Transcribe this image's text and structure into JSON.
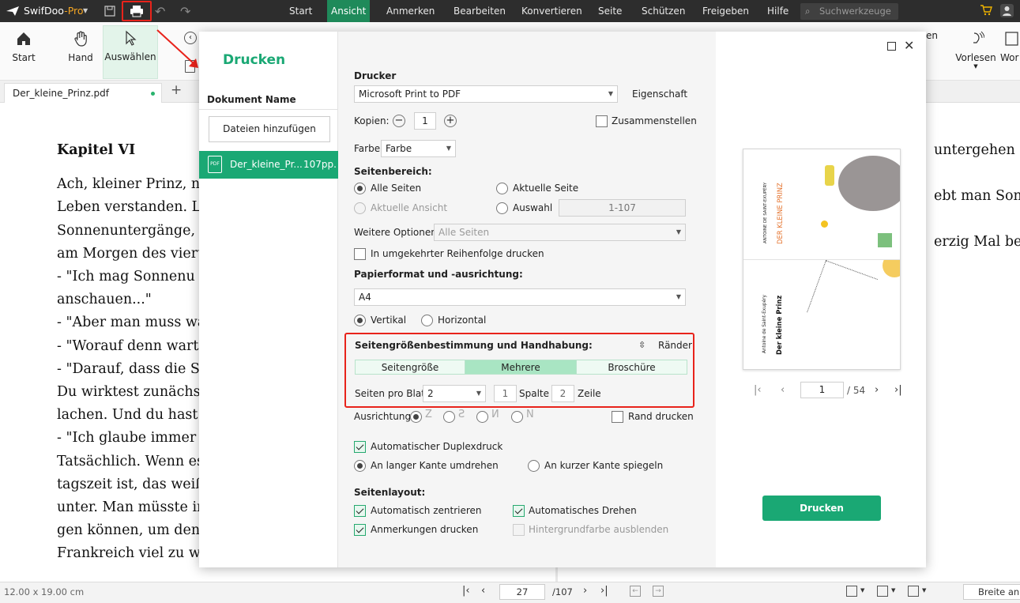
{
  "app": {
    "name": "SwifDoo",
    "suffix": "-Pro"
  },
  "menu": {
    "items": [
      "Start",
      "Ansicht",
      "Anmerken",
      "Bearbeiten",
      "Konvertieren",
      "Seite",
      "Schützen",
      "Freigeben",
      "Hilfe"
    ],
    "active": "Ansicht",
    "search_placeholder": "Suchwerkzeuge"
  },
  "toolbar": {
    "start": "Start",
    "hand": "Hand",
    "select": "Auswählen",
    "read_aloud": "Vorlesen",
    "wor": "Wor",
    "en": "en"
  },
  "tab": {
    "name": "Der_kleine_Prinz.pdf"
  },
  "document": {
    "left_lines": [
      "Kapitel VI",
      "Ach, kleiner Prinz, na",
      "Leben verstanden. La",
      "Sonnenuntergänge, un",
      "am Morgen des vierte",
      "- \"Ich mag Sonnenu",
      "anschauen...\"",
      "- \"Aber man muss wa",
      "- \"Worauf denn warten",
      "- \"Darauf, dass die So",
      "Du wirktest zunächst",
      "lachen. Und du hast zu",
      "- \"Ich glaube immer n",
      "Tatsächlich. Wenn es",
      "tagszeit ist, das weiß",
      "unter. Man müsste in",
      "gen können, um den",
      "Frankreich viel zu we"
    ],
    "right_lines": [
      "untergehen sel",
      "ebt man Sonne",
      "erzig Mal besor"
    ]
  },
  "status": {
    "page_size": "12.00 x 19.00 cm",
    "current_page": "27",
    "total_pages": "/107",
    "zoom": "Breite anp"
  },
  "dialog": {
    "title": "Drucken",
    "doc_header": "Dokument Name",
    "add_files": "Dateien hinzufügen",
    "file_name": "Der_kleine_Pr...",
    "file_pages": "107pp.",
    "printer_label": "Drucker",
    "printer_value": "Microsoft Print to PDF",
    "properties": "Eigenschaft",
    "copies_label": "Kopien:",
    "copies_value": "1",
    "collate": "Zusammenstellen",
    "color_label": "Farbe",
    "color_value": "Farbe",
    "range_label": "Seitenbereich:",
    "all_pages": "Alle Seiten",
    "current_page": "Aktuelle Seite",
    "current_view": "Aktuelle Ansicht",
    "selection": "Auswahl",
    "selection_value": "1-107",
    "more_options": "Weitere Optionen:",
    "more_options_value": "Alle Seiten",
    "reverse": "In umgekehrter Reihenfolge drucken",
    "paper_label": "Papierformat und -ausrichtung:",
    "paper_value": "A4",
    "portrait": "Vertikal",
    "landscape": "Horizontal",
    "sizing_label": "Seitengrößenbestimmung und Handhabung:",
    "margins": "Ränder",
    "seg_page_size": "Seitengröße",
    "seg_multiple": "Mehrere",
    "seg_booklet": "Broschüre",
    "pages_per_sheet_label": "Seiten pro Blatt:",
    "pages_per_sheet_value": "2",
    "columns_value": "1",
    "columns_label": "Spalte",
    "rows_value": "2",
    "rows_label": "Zeile",
    "orientation_label": "Ausrichtung",
    "print_border": "Rand drucken",
    "duplex": "Automatischer Duplexdruck",
    "long_edge": "An langer Kante umdrehen",
    "short_edge": "An kurzer Kante spiegeln",
    "layout_label": "Seitenlayout:",
    "auto_center": "Automatisch zentrieren",
    "auto_rotate": "Automatisches Drehen",
    "print_annotations": "Anmerkungen drucken",
    "hide_background": "Hintergrundfarbe ausblenden",
    "preview_page": "1",
    "preview_total": "/ 54",
    "print_button": "Drucken"
  },
  "preview": {
    "top_author": "ANTOINE DE SAINT-EXUPÉRY",
    "top_title": "DER KLEINE PRINZ",
    "bottom_author": "Antoine de Saint-Exupéry",
    "bottom_title": "Der kleine Prinz"
  },
  "colors": {
    "accent": "#1aa874",
    "highlight": "#e8231b",
    "title_bar": "#2d2d2d"
  }
}
